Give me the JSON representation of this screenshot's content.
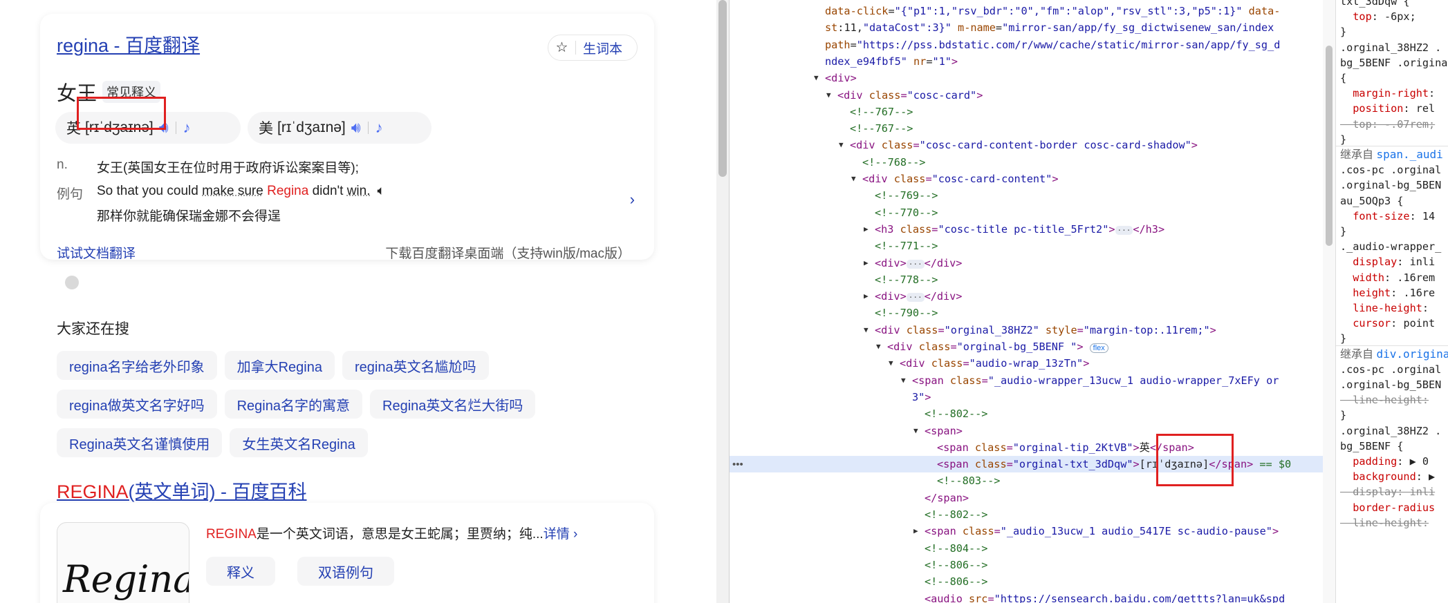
{
  "dict_card": {
    "title": "regina - 百度翻译",
    "vocab_label": "生词本",
    "word": "女王",
    "word_tag": "常见释义",
    "uk_tip": "英",
    "uk_phonetic": "[rɪˈdʒaɪnə]",
    "us_tip": "美",
    "us_phonetic": "[rɪˈdʒaɪnə]",
    "pos": "n.",
    "definition": "女王(英国女王在位时用于政府诉讼案案目等);",
    "example_label": "例句",
    "example_en_1": "So that you could ",
    "example_en_2": "make sure",
    "example_en_hl": "Regina",
    "example_en_3": " didn't ",
    "example_en_4": "win.",
    "example_zh": "那样你就能确保瑞金娜不会得逞",
    "doc_translate": "试试文档翻译",
    "download": "下载百度翻译桌面端（支持win版/mac版）"
  },
  "related": {
    "title": "大家还在搜",
    "items": [
      "regina名字给老外印象",
      "加拿大Regina",
      "regina英文名尴尬吗",
      "regina做英文名字好吗",
      "Regina名字的寓意",
      "Regina英文名烂大街吗",
      "Regina英文名谨慎使用",
      "女生英文名Regina"
    ]
  },
  "baike": {
    "title_hl": "REGINA",
    "title_rest": "(英文单词) - 百度百科",
    "image_text": "Regina",
    "desc_hl": "REGINA",
    "desc_rest": "是一个英文词语，意思是女王蛇属；里贾纳；纯...",
    "more": "详情 ›",
    "tab_def": "释义",
    "tab_ex": "双语例句"
  },
  "elements": [
    {
      "i": 0,
      "ind": 0,
      "t": [
        [
          "at",
          "data-click"
        ],
        [
          "tx",
          "="
        ],
        [
          "av",
          "\"{\"p1\":1,\"rsv_bdr\":\"0\",\"fm\":\"alop\",\"rsv_stl\":3,\"p5\":1}\""
        ],
        [
          "tx",
          " "
        ],
        [
          "at",
          "data-"
        ]
      ]
    },
    {
      "i": 1,
      "ind": 0,
      "t": [
        [
          "at",
          "st"
        ],
        [
          "tx",
          ":11,"
        ],
        [
          "av",
          "\"dataCost\":3}\""
        ],
        [
          "tx",
          " "
        ],
        [
          "at",
          "m-name"
        ],
        [
          "tx",
          "="
        ],
        [
          "av",
          "\"mirror-san/app/fy_sg_dictwisenew_san/index"
        ]
      ]
    },
    {
      "i": 2,
      "ind": 0,
      "t": [
        [
          "at",
          "path"
        ],
        [
          "tx",
          "="
        ],
        [
          "av",
          "\"https://pss.bdstatic.com/r/www/cache/static/mirror-san/app/fy_sg_d"
        ]
      ]
    },
    {
      "i": 3,
      "ind": 0,
      "t": [
        [
          "av",
          "ndex_e94fbf5\""
        ],
        [
          "tx",
          " "
        ],
        [
          "at",
          "nr"
        ],
        [
          "tx",
          "="
        ],
        [
          "av",
          "\"1\""
        ],
        [
          "tg",
          ">"
        ]
      ]
    },
    {
      "i": 4,
      "ind": 0,
      "tri": "▼",
      "t": [
        [
          "tg",
          "<div>"
        ]
      ]
    },
    {
      "i": 5,
      "ind": 1,
      "tri": "▼",
      "t": [
        [
          "tg",
          "<div "
        ],
        [
          "at",
          "class"
        ],
        [
          "tg",
          "="
        ],
        [
          "av",
          "\"cosc-card\""
        ],
        [
          "tg",
          ">"
        ]
      ]
    },
    {
      "i": 6,
      "ind": 2,
      "t": [
        [
          "cm",
          "<!--767-->"
        ]
      ]
    },
    {
      "i": 7,
      "ind": 2,
      "t": [
        [
          "cm",
          "<!--767-->"
        ]
      ]
    },
    {
      "i": 8,
      "ind": 2,
      "tri": "▼",
      "t": [
        [
          "tg",
          "<div "
        ],
        [
          "at",
          "class"
        ],
        [
          "tg",
          "="
        ],
        [
          "av",
          "\"cosc-card-content-border cosc-card-shadow\""
        ],
        [
          "tg",
          ">"
        ]
      ]
    },
    {
      "i": 9,
      "ind": 3,
      "t": [
        [
          "cm",
          "<!--768-->"
        ]
      ]
    },
    {
      "i": 10,
      "ind": 3,
      "tri": "▼",
      "t": [
        [
          "tg",
          "<div "
        ],
        [
          "at",
          "class"
        ],
        [
          "tg",
          "="
        ],
        [
          "av",
          "\"cosc-card-content\""
        ],
        [
          "tg",
          ">"
        ]
      ]
    },
    {
      "i": 11,
      "ind": 4,
      "t": [
        [
          "cm",
          "<!--769-->"
        ]
      ]
    },
    {
      "i": 12,
      "ind": 4,
      "t": [
        [
          "cm",
          "<!--770-->"
        ]
      ]
    },
    {
      "i": 13,
      "ind": 4,
      "tri": "▶",
      "t": [
        [
          "tg",
          "<h3 "
        ],
        [
          "at",
          "class"
        ],
        [
          "tg",
          "="
        ],
        [
          "av",
          "\"cosc-title pc-title_5Frt2\""
        ],
        [
          "tg",
          ">"
        ],
        [
          "ell",
          "···"
        ],
        [
          "tg",
          "</h3>"
        ]
      ]
    },
    {
      "i": 14,
      "ind": 4,
      "t": [
        [
          "cm",
          "<!--771-->"
        ]
      ]
    },
    {
      "i": 15,
      "ind": 4,
      "tri": "▶",
      "t": [
        [
          "tg",
          "<div>"
        ],
        [
          "ell",
          "···"
        ],
        [
          "tg",
          "</div>"
        ]
      ]
    },
    {
      "i": 16,
      "ind": 4,
      "t": [
        [
          "cm",
          "<!--778-->"
        ]
      ]
    },
    {
      "i": 17,
      "ind": 4,
      "tri": "▶",
      "t": [
        [
          "tg",
          "<div>"
        ],
        [
          "ell",
          "···"
        ],
        [
          "tg",
          "</div>"
        ]
      ]
    },
    {
      "i": 18,
      "ind": 4,
      "t": [
        [
          "cm",
          "<!--790-->"
        ]
      ]
    },
    {
      "i": 19,
      "ind": 4,
      "tri": "▼",
      "t": [
        [
          "tg",
          "<div "
        ],
        [
          "at",
          "class"
        ],
        [
          "tg",
          "="
        ],
        [
          "av",
          "\"orginal_38HZ2\""
        ],
        [
          "tx",
          " "
        ],
        [
          "at",
          "style"
        ],
        [
          "tg",
          "="
        ],
        [
          "av",
          "\"margin-top:.11rem;\""
        ],
        [
          "tg",
          ">"
        ]
      ]
    },
    {
      "i": 20,
      "ind": 5,
      "tri": "▼",
      "t": [
        [
          "tg",
          "<div "
        ],
        [
          "at",
          "class"
        ],
        [
          "tg",
          "="
        ],
        [
          "av",
          "\"orginal-bg_5BENF \""
        ],
        [
          "tg",
          ">"
        ],
        [
          "tx",
          " "
        ],
        [
          "badge",
          "flex"
        ]
      ]
    },
    {
      "i": 21,
      "ind": 6,
      "tri": "▼",
      "t": [
        [
          "tg",
          "<div "
        ],
        [
          "at",
          "class"
        ],
        [
          "tg",
          "="
        ],
        [
          "av",
          "\"audio-wrap_13zTn\""
        ],
        [
          "tg",
          ">"
        ]
      ]
    },
    {
      "i": 22,
      "ind": 7,
      "tri": "▼",
      "t": [
        [
          "tg",
          "<span "
        ],
        [
          "at",
          "class"
        ],
        [
          "tg",
          "="
        ],
        [
          "av",
          "\"_audio-wrapper_13ucw_1 audio-wrapper_7xEFy or"
        ]
      ]
    },
    {
      "i": 23,
      "ind": 7,
      "t": [
        [
          "av",
          "3\""
        ],
        [
          "tg",
          ">"
        ]
      ]
    },
    {
      "i": 24,
      "ind": 8,
      "t": [
        [
          "cm",
          "<!--802-->"
        ]
      ]
    },
    {
      "i": 25,
      "ind": 8,
      "tri": "▼",
      "t": [
        [
          "tg",
          "<span>"
        ]
      ]
    },
    {
      "i": 26,
      "ind": 9,
      "t": [
        [
          "tg",
          "<span "
        ],
        [
          "at",
          "class"
        ],
        [
          "tg",
          "="
        ],
        [
          "av",
          "\"orginal-tip_2KtVB\""
        ],
        [
          "tg",
          ">"
        ],
        [
          "tx",
          "英"
        ],
        [
          "tg",
          "</span>"
        ]
      ]
    },
    {
      "i": 27,
      "ind": 9,
      "sel": true,
      "t": [
        [
          "tg",
          "<span "
        ],
        [
          "at",
          "class"
        ],
        [
          "tg",
          "="
        ],
        [
          "av",
          "\"orginal-txt_3dDqw\""
        ],
        [
          "tg",
          ">"
        ],
        [
          "tx",
          "[rɪˈdʒaɪnə]"
        ],
        [
          "tg",
          "</span>"
        ],
        [
          "cm",
          " == $0"
        ]
      ]
    },
    {
      "i": 28,
      "ind": 9,
      "t": [
        [
          "cm",
          "<!--803-->"
        ]
      ]
    },
    {
      "i": 29,
      "ind": 8,
      "t": [
        [
          "tg",
          "</span>"
        ]
      ]
    },
    {
      "i": 30,
      "ind": 8,
      "t": [
        [
          "cm",
          "<!--802-->"
        ]
      ]
    },
    {
      "i": 31,
      "ind": 8,
      "tri": "▶",
      "t": [
        [
          "tg",
          "<span "
        ],
        [
          "at",
          "class"
        ],
        [
          "tg",
          "="
        ],
        [
          "av",
          "\"_audio_13ucw_1 audio_5417E sc-audio-pause\""
        ],
        [
          "tg",
          ">"
        ]
      ]
    },
    {
      "i": 32,
      "ind": 8,
      "t": [
        [
          "cm",
          "<!--804-->"
        ]
      ]
    },
    {
      "i": 33,
      "ind": 8,
      "t": [
        [
          "cm",
          "<!--806-->"
        ]
      ]
    },
    {
      "i": 34,
      "ind": 8,
      "t": [
        [
          "cm",
          "<!--806-->"
        ]
      ]
    },
    {
      "i": 35,
      "ind": 8,
      "t": [
        [
          "tg",
          "<audio "
        ],
        [
          "at",
          "src"
        ],
        [
          "tg",
          "="
        ],
        [
          "av",
          "\"https://sensearch.baidu.com/gettts?lan=uk&spd"
        ]
      ]
    }
  ],
  "styles": [
    {
      "r": 0,
      "t": [
        [
          "sel-name",
          "txt_3dDqw {"
        ]
      ]
    },
    {
      "r": 1,
      "t": [
        [
          "prop",
          "  top"
        ],
        [
          "val",
          ": -6px;"
        ]
      ]
    },
    {
      "r": 2,
      "t": [
        [
          "val",
          "}"
        ]
      ]
    },
    {
      "r": 3,
      "t": [
        [
          "sel-name",
          ".orginal_38HZ2 ."
        ]
      ]
    },
    {
      "r": 4,
      "t": [
        [
          "sel-name",
          "bg_5BENF .origina"
        ]
      ]
    },
    {
      "r": 5,
      "t": [
        [
          "val",
          "{"
        ]
      ]
    },
    {
      "r": 6,
      "t": [
        [
          "prop",
          "  margin-right"
        ],
        [
          "val",
          ":"
        ]
      ]
    },
    {
      "r": 7,
      "t": [
        [
          "prop",
          "  position"
        ],
        [
          "val",
          ": rel"
        ]
      ]
    },
    {
      "r": 8,
      "t": [
        [
          "strike",
          "  top: -.07rem;"
        ]
      ]
    },
    {
      "r": 9,
      "t": [
        [
          "val",
          "}"
        ]
      ]
    },
    {
      "r": 10,
      "inh": [
        "继承自 ",
        "span._audi"
      ]
    },
    {
      "r": 11,
      "t": [
        [
          "sel-name",
          ".cos-pc .orginal"
        ]
      ]
    },
    {
      "r": 12,
      "t": [
        [
          "sel-name",
          ".orginal-bg_5BEN"
        ]
      ]
    },
    {
      "r": 13,
      "t": [
        [
          "sel-name",
          "au_5OQp3 {"
        ]
      ]
    },
    {
      "r": 14,
      "t": [
        [
          "prop",
          "  font-size"
        ],
        [
          "val",
          ": 14"
        ]
      ]
    },
    {
      "r": 15,
      "t": [
        [
          "val",
          "}"
        ]
      ]
    },
    {
      "r": 16,
      "t": [
        [
          "sel-name",
          "._audio-wrapper_"
        ]
      ]
    },
    {
      "r": 17,
      "t": [
        [
          "prop",
          "  display"
        ],
        [
          "val",
          ": inli"
        ]
      ]
    },
    {
      "r": 18,
      "t": [
        [
          "prop",
          "  width"
        ],
        [
          "val",
          ": .16rem"
        ]
      ]
    },
    {
      "r": 19,
      "t": [
        [
          "prop",
          "  height"
        ],
        [
          "val",
          ": .16re"
        ]
      ]
    },
    {
      "r": 20,
      "t": [
        [
          "prop",
          "  line-height"
        ],
        [
          "val",
          ":"
        ]
      ]
    },
    {
      "r": 21,
      "t": [
        [
          "prop",
          "  cursor"
        ],
        [
          "val",
          ": point"
        ]
      ]
    },
    {
      "r": 22,
      "t": [
        [
          "val",
          "}"
        ]
      ]
    },
    {
      "r": 23,
      "inh": [
        "继承自 ",
        "div.origina"
      ]
    },
    {
      "r": 24,
      "t": [
        [
          "sel-name",
          ".cos-pc .orginal"
        ]
      ]
    },
    {
      "r": 25,
      "t": [
        [
          "sel-name",
          ".orginal-bg_5BEN"
        ]
      ]
    },
    {
      "r": 26,
      "t": [
        [
          "strike",
          "  line-height:"
        ]
      ]
    },
    {
      "r": 27,
      "t": [
        [
          "val",
          "}"
        ]
      ]
    },
    {
      "r": 28,
      "t": [
        [
          "sel-name",
          ".orginal_38HZ2 ."
        ]
      ]
    },
    {
      "r": 29,
      "t": [
        [
          "sel-name",
          "bg_5BENF {"
        ]
      ]
    },
    {
      "r": 30,
      "t": [
        [
          "prop",
          "  padding"
        ],
        [
          "val",
          ": ▶ 0"
        ]
      ]
    },
    {
      "r": 31,
      "t": [
        [
          "prop",
          "  background"
        ],
        [
          "val",
          ": ▶"
        ]
      ]
    },
    {
      "r": 32,
      "t": [
        [
          "strike",
          "  display: inli"
        ]
      ]
    },
    {
      "r": 33,
      "t": [
        [
          "prop",
          "  border-radius"
        ]
      ]
    },
    {
      "r": 34,
      "t": [
        [
          "strike",
          "  line-height:"
        ]
      ]
    }
  ]
}
